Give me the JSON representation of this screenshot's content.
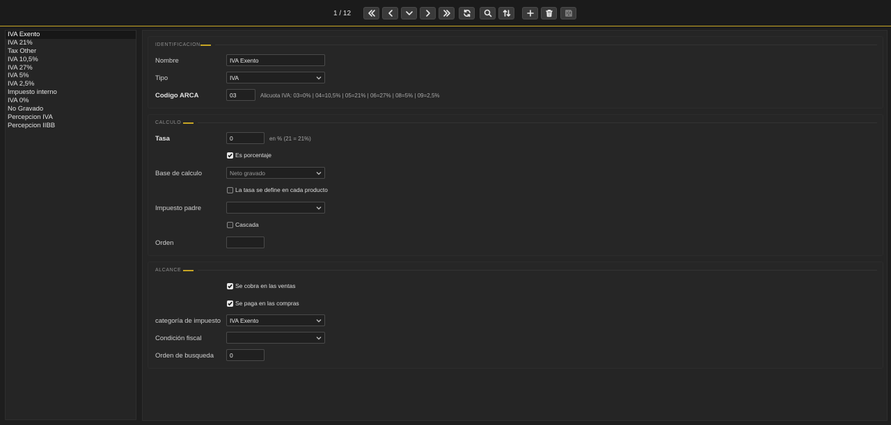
{
  "toolbar": {
    "page_counter": "1 / 12",
    "buttons": [
      {
        "name": "first-page",
        "icon": "chevrons-left-icon"
      },
      {
        "name": "previous-page",
        "icon": "chevron-left-icon"
      },
      {
        "name": "dropdown",
        "icon": "chevron-down-icon"
      },
      {
        "name": "next-page",
        "icon": "chevron-right-icon"
      },
      {
        "name": "last-page",
        "icon": "chevrons-right-icon"
      },
      {
        "name": "refresh",
        "icon": "refresh-icon"
      },
      {
        "name": "search",
        "icon": "search-icon"
      },
      {
        "name": "sort",
        "icon": "sort-arrows-icon"
      },
      {
        "name": "add",
        "icon": "plus-icon"
      },
      {
        "name": "delete",
        "icon": "trash-icon"
      },
      {
        "name": "save",
        "icon": "save-icon"
      }
    ],
    "accent_color": "#c8a624"
  },
  "sidebar": {
    "items": [
      {
        "label": "IVA Exento"
      },
      {
        "label": "IVA 21%"
      },
      {
        "label": "Tax Other"
      },
      {
        "label": "IVA 10,5%"
      },
      {
        "label": "IVA 27%"
      },
      {
        "label": "IVA 5%"
      },
      {
        "label": "IVA 2,5%"
      },
      {
        "label": "Impuesto interno"
      },
      {
        "label": "IVA 0%"
      },
      {
        "label": "No Gravado"
      },
      {
        "label": "Percepcion IVA"
      },
      {
        "label": "Percepcion IIBB"
      }
    ]
  },
  "identificacion": {
    "title": "IDENTIFICACION",
    "nombre_label": "Nombre",
    "nombre_value": "IVA Exento",
    "tipo_label": "Tipo",
    "tipo_value": "IVA",
    "codigo_label": "Codigo ARCA",
    "codigo_value": "03",
    "codigo_hint": "Alicuota IVA: 03=0% | 04=10,5% | 05=21% | 06=27% | 08=5% | 09=2,5%"
  },
  "calculo": {
    "title": "CALCULO",
    "tasa_label": "Tasa",
    "tasa_value": "0",
    "tasa_hint": "en % (21 = 21%)",
    "es_porcentaje_label": "Es porcentaje",
    "base_label": "Base de calculo",
    "base_value": "Neto gravado",
    "tasa_producto_label": "La tasa se define en cada producto",
    "impuesto_padre_label": "Impuesto padre",
    "impuesto_padre_value": "",
    "cascada_label": "Cascada",
    "orden_label": "Orden",
    "orden_value": ""
  },
  "alcance": {
    "title": "ALCANCE",
    "ventas_label": "Se cobra en las ventas",
    "compras_label": "Se paga en las compras",
    "categoria_label": "categoría de impuesto",
    "categoria_value": "IVA Exento",
    "condicion_label": "Condición fiscal",
    "condicion_value": "",
    "orden_busqueda_label": "Orden de busqueda",
    "orden_busqueda_value": "0"
  }
}
